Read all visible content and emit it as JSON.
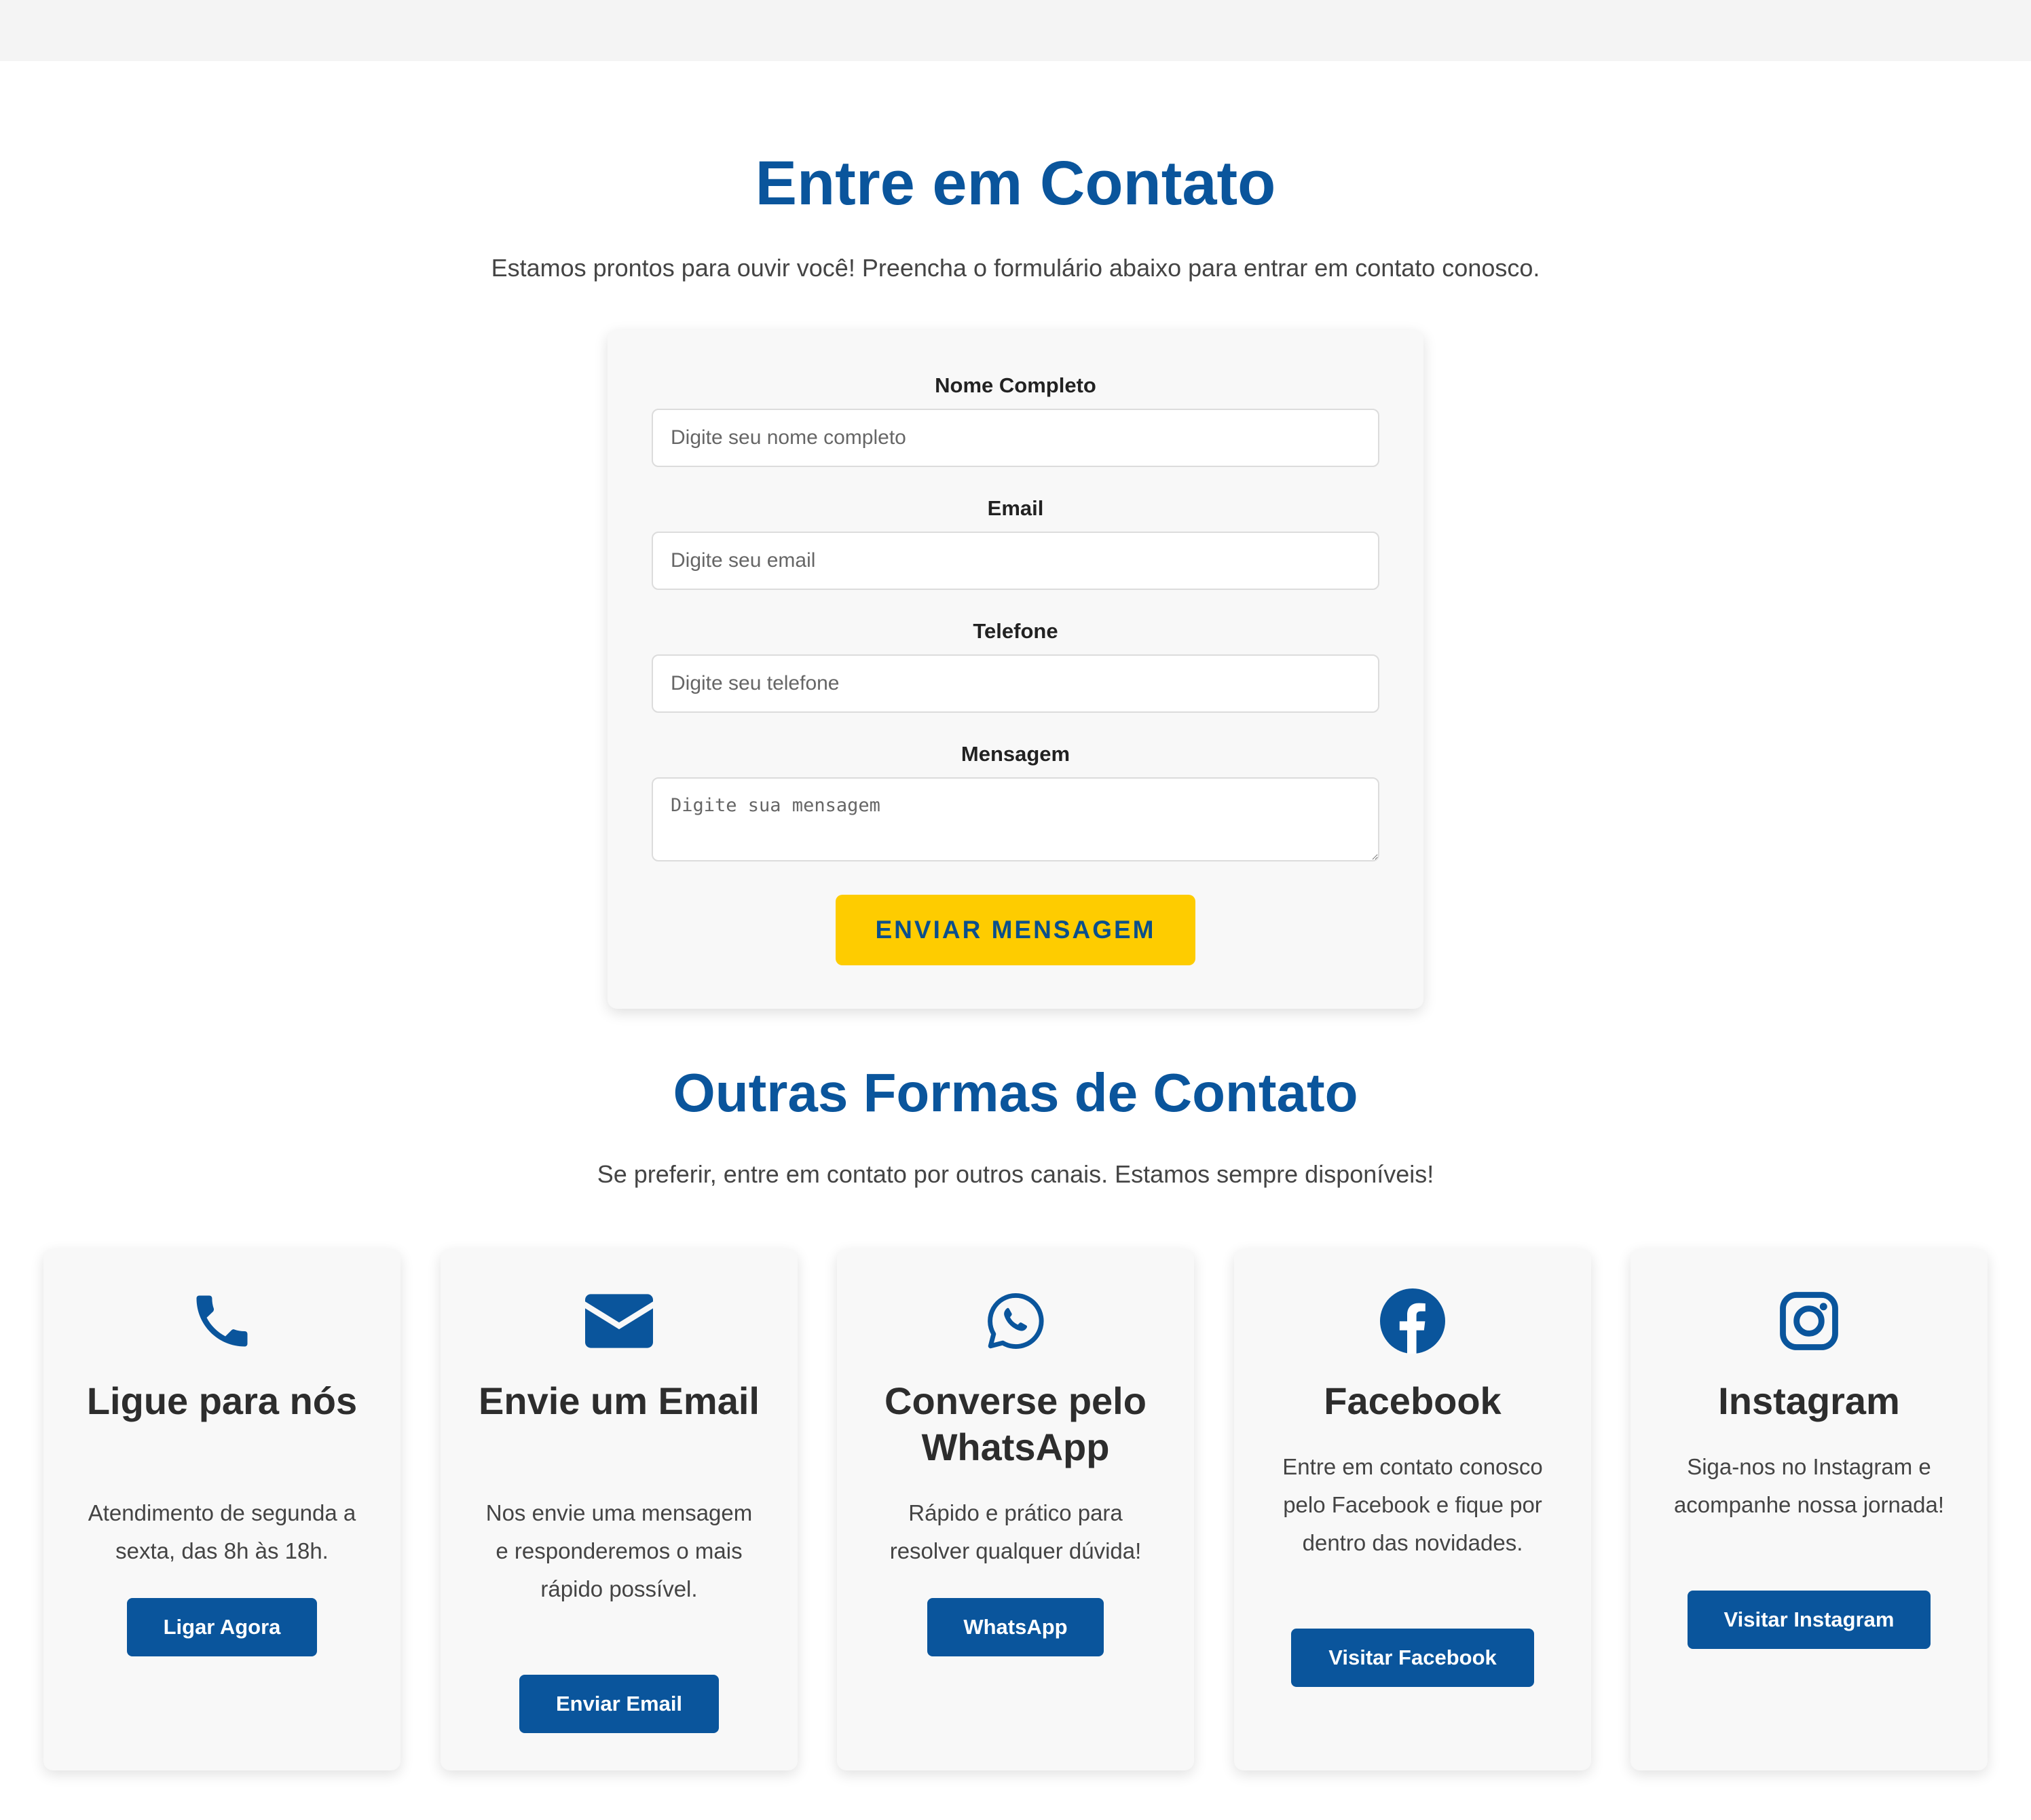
{
  "page": {
    "title": "Entre em Contato",
    "subtitle": "Estamos prontos para ouvir você! Preencha o formulário abaixo para entrar em contato conosco."
  },
  "form": {
    "name_label": "Nome Completo",
    "name_placeholder": "Digite seu nome completo",
    "email_label": "Email",
    "email_placeholder": "Digite seu email",
    "phone_label": "Telefone",
    "phone_placeholder": "Digite seu telefone",
    "message_label": "Mensagem",
    "message_placeholder": "Digite sua mensagem",
    "submit_label": "ENVIAR MENSAGEM"
  },
  "other": {
    "title": "Outras Formas de Contato",
    "subtitle": "Se preferir, entre em contato por outros canais. Estamos sempre disponíveis!"
  },
  "cards": [
    {
      "icon": "phone-icon",
      "title": "Ligue para nós",
      "text": "Atendimento de segunda a sexta, das 8h às 18h.",
      "button": "Ligar Agora"
    },
    {
      "icon": "envelope-icon",
      "title": "Envie um Email",
      "text": "Nos envie uma mensagem e responderemos o mais rápido possível.",
      "button": "Enviar Email"
    },
    {
      "icon": "whatsapp-icon",
      "title": "Converse pelo WhatsApp",
      "text": "Rápido e prático para resolver qualquer dúvida!",
      "button": "WhatsApp"
    },
    {
      "icon": "facebook-icon",
      "title": "Facebook",
      "text": "Entre em contato conosco pelo Facebook e fique por dentro das novidades.",
      "button": "Visitar Facebook"
    },
    {
      "icon": "instagram-icon",
      "title": "Instagram",
      "text": "Siga-nos no Instagram e acompanhe nossa jornada!",
      "button": "Visitar Instagram"
    }
  ],
  "colors": {
    "primary": "#0a559c",
    "accent": "#fecc00",
    "card_bg": "#f8f8f8"
  }
}
